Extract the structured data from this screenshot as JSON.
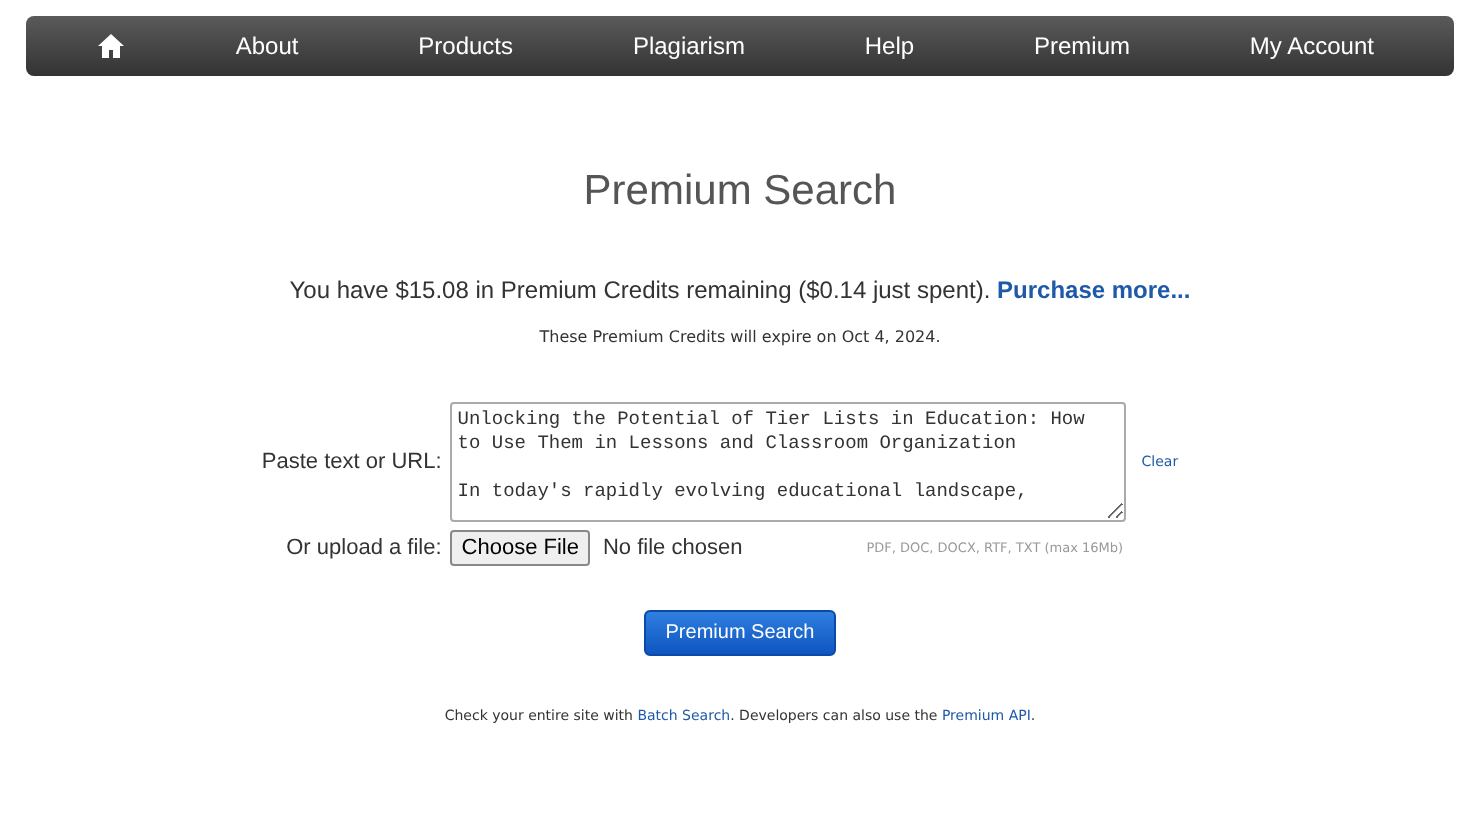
{
  "nav": {
    "items": [
      {
        "kind": "home"
      },
      {
        "kind": "text",
        "label": "About"
      },
      {
        "kind": "text",
        "label": "Products"
      },
      {
        "kind": "text",
        "label": "Plagiarism"
      },
      {
        "kind": "text",
        "label": "Help"
      },
      {
        "kind": "text",
        "label": "Premium"
      },
      {
        "kind": "text",
        "label": "My Account"
      }
    ]
  },
  "heading": "Premium Search",
  "credits": {
    "text": "You have $15.08 in Premium Credits remaining ($0.14 just spent).",
    "link": "Purchase more..."
  },
  "expiry": "These Premium Credits will expire on Oct 4, 2024.",
  "paste": {
    "label": "Paste text or URL:",
    "value": "Unlocking the Potential of Tier Lists in Education: How to Use Them in Lessons and Classroom Organization\n\nIn today's rapidly evolving educational landscape,",
    "clear": "Clear"
  },
  "upload": {
    "label": "Or upload a file:",
    "button": "Choose File",
    "status": "No file chosen",
    "formats": "PDF, DOC, DOCX, RTF, TXT (max 16Mb)"
  },
  "submit": "Premium Search",
  "footer": {
    "before": "Check your entire site with ",
    "link1": "Batch Search",
    "middle": ". Developers can also use the ",
    "link2": "Premium API",
    "after": "."
  }
}
